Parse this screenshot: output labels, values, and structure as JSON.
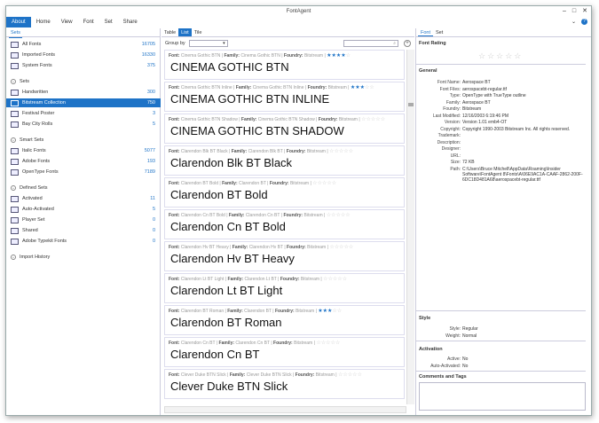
{
  "app": {
    "title": "FontAgent",
    "win_min": "–",
    "win_max": "□",
    "win_close": "✕"
  },
  "menu": {
    "items": [
      "About",
      "Home",
      "View",
      "Font",
      "Set",
      "Share"
    ],
    "chevron": "⌄",
    "help": "?"
  },
  "left": {
    "tab": "Sets",
    "top_items": [
      {
        "label": "All Fonts",
        "count": "16705"
      },
      {
        "label": "Imported Fonts",
        "count": "16330"
      },
      {
        "label": "System Fonts",
        "count": "375"
      }
    ],
    "sets_header": "Sets",
    "sets": [
      {
        "label": "Handwritten",
        "count": "300"
      },
      {
        "label": "Bitstream Collection",
        "count": "750"
      },
      {
        "label": "Festival Poster",
        "count": "3"
      },
      {
        "label": "Bay City Rolls",
        "count": "5"
      }
    ],
    "smart_header": "Smart Sets",
    "smart": [
      {
        "label": "Italic Fonts",
        "count": "5077"
      },
      {
        "label": "Adobe Fonts",
        "count": "193"
      },
      {
        "label": "OpenType Fonts",
        "count": "7189"
      }
    ],
    "defined_header": "Defined Sets",
    "defined": [
      {
        "label": "Activated",
        "count": "11"
      },
      {
        "label": "Auto-Activated",
        "count": "5"
      },
      {
        "label": "Player Set",
        "count": "0"
      },
      {
        "label": "Shared",
        "count": "0"
      },
      {
        "label": "Adobe Typekit Fonts",
        "count": "0"
      }
    ],
    "import_history": "Import History"
  },
  "mid": {
    "tabs": [
      "Table",
      "List",
      "Tile"
    ],
    "group_by": "Group by",
    "labels": {
      "font": "Font:",
      "family": "Family:",
      "foundry": "Foundry:"
    },
    "fonts": [
      {
        "font": "Cinema Gothic BTN",
        "family": "Cinema Gothic BTN",
        "foundry": "Bitstream",
        "stars": 4,
        "sample": "CINEMA GOTHIC BTN"
      },
      {
        "font": "Cinema Gothic BTN Inline",
        "family": "Cinema Gothic BTN Inline",
        "foundry": "Bitstream",
        "stars": 3,
        "sample": "CINEMA GOTHIC BTN INLINE"
      },
      {
        "font": "Cinema Gothic BTN Shadow",
        "family": "Cinema Gothic BTN Shadow",
        "foundry": "Bitstream",
        "stars": 0,
        "sample": "CINEMA GOTHIC BTN SHADOW"
      },
      {
        "font": "Clarendon Blk BT Black",
        "family": "Clarendon Blk BT",
        "foundry": "Bitstream",
        "stars": 0,
        "sample": "Clarendon Blk BT Black"
      },
      {
        "font": "Clarendon BT Bold",
        "family": "Clarendon BT",
        "foundry": "Bitstream",
        "stars": 0,
        "sample": "Clarendon BT Bold"
      },
      {
        "font": "Clarendon Cn BT Bold",
        "family": "Clarendon Cn BT",
        "foundry": "Bitstream",
        "stars": 0,
        "sample": "Clarendon Cn BT Bold"
      },
      {
        "font": "Clarendon Hv BT Heavy",
        "family": "Clarendon Hv BT",
        "foundry": "Bitstream",
        "stars": 0,
        "sample": "Clarendon Hv BT Heavy"
      },
      {
        "font": "Clarendon Lt BT Light",
        "family": "Clarendon Lt BT",
        "foundry": "Bitstream",
        "stars": 0,
        "sample": "Clarendon Lt BT Light"
      },
      {
        "font": "Clarendon BT Roman",
        "family": "Clarendon BT",
        "foundry": "Bitstream",
        "stars": 3,
        "sample": "Clarendon BT Roman"
      },
      {
        "font": "Clarendon Cn BT",
        "family": "Clarendon Cn BT",
        "foundry": "Bitstream",
        "stars": 0,
        "sample": "Clarendon Cn BT"
      },
      {
        "font": "Clever Duke BTN Slick",
        "family": "Clever Duke BTN Slick",
        "foundry": "Bitstream",
        "stars": 0,
        "sample": "Clever Duke BTN Slick"
      }
    ]
  },
  "right": {
    "tabs": [
      "Font",
      "Set"
    ],
    "rating_title": "Font Rating",
    "general_title": "General",
    "props": [
      {
        "k": "Font Name:",
        "v": "Aerospace BT"
      },
      {
        "k": "Font Files:",
        "v": "aerospacebt-regular.ttf"
      },
      {
        "k": "Type:",
        "v": "OpenType with TrueType outline"
      },
      {
        "k": "Family:",
        "v": "Aerospace BT"
      },
      {
        "k": "Foundry:",
        "v": "Bitstream"
      },
      {
        "k": "Last Modified:",
        "v": "12/16/2003 6:19:46 PM"
      },
      {
        "k": "Version:",
        "v": "Version 1.01 emb4-OT"
      },
      {
        "k": "Copyright:",
        "v": "Copyright 1990-2003 Bitstream Inc. All rights reserved."
      },
      {
        "k": "Trademark:",
        "v": ""
      },
      {
        "k": "Description:",
        "v": ""
      },
      {
        "k": "Designer:",
        "v": ""
      },
      {
        "k": "URL:",
        "v": ""
      },
      {
        "k": "Size:",
        "v": "72 KB"
      },
      {
        "k": "Path:",
        "v": "C:\\Users\\Bruce Mitchell\\AppData\\Roaming\\Insider Software\\FontAgent 8\\Fonts\\A\\06E9AC1A-CAAF-2862-200F-6DC18D481A68\\aerospacebt-regular.ttf"
      }
    ],
    "style_title": "Style",
    "style_props": [
      {
        "k": "Style:",
        "v": "Regular"
      },
      {
        "k": "Weight:",
        "v": "Normal"
      }
    ],
    "activation_title": "Activation",
    "activation_props": [
      {
        "k": "Active:",
        "v": "No"
      },
      {
        "k": "Auto-Activated:",
        "v": "No"
      }
    ],
    "comments_title": "Comments and Tags"
  },
  "colors": {
    "accent": "#1e73c7"
  }
}
